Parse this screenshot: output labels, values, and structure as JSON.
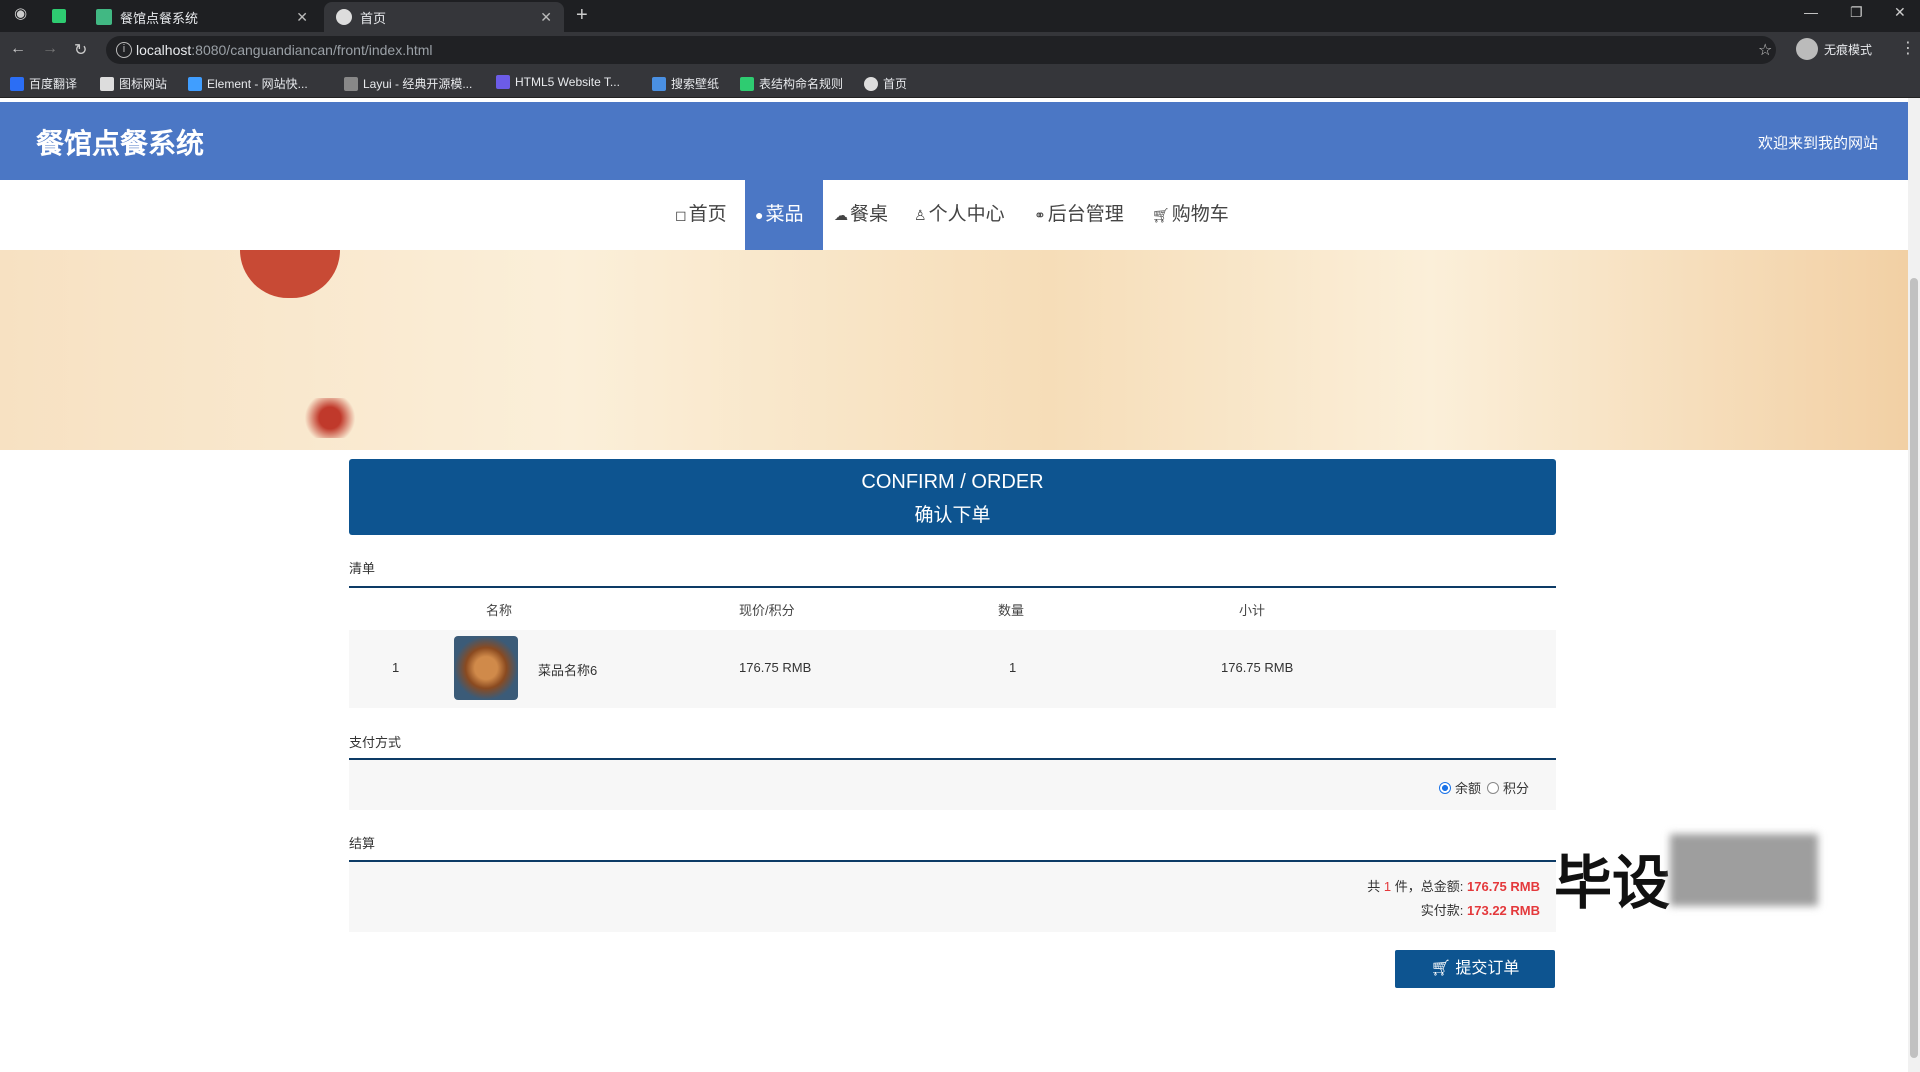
{
  "browser": {
    "tabs": [
      {
        "title": "餐馆点餐系统",
        "active": false
      },
      {
        "title": "首页",
        "active": true
      }
    ],
    "url_host": "localhost",
    "url_rest": ":8080/canguandiancan/front/index.html",
    "profile_label": "无痕模式",
    "bookmarks": [
      "百度翻译",
      "图标网站",
      "Element - 网站快...",
      "Layui - 经典开源模...",
      "HTML5 Website T...",
      "搜索壁纸",
      "表结构命名规则",
      "首页"
    ]
  },
  "site": {
    "title": "餐馆点餐系统",
    "welcome": "欢迎来到我的网站"
  },
  "nav": {
    "items": [
      "首页",
      "菜品",
      "餐桌",
      "个人中心",
      "后台管理",
      "购物车"
    ],
    "active": "菜品"
  },
  "confirm": {
    "title_en": "CONFIRM / ORDER",
    "title_zh": "确认下单"
  },
  "list": {
    "label": "清单",
    "headers": [
      "名称",
      "现价/积分",
      "数量",
      "小计"
    ],
    "rows": [
      {
        "index": "1",
        "name": "菜品名称6",
        "price": "176.75 RMB",
        "qty": "1",
        "subtotal": "176.75 RMB"
      }
    ]
  },
  "payment": {
    "label": "支付方式",
    "options": [
      "余额",
      "积分"
    ],
    "selected": "余额"
  },
  "settle": {
    "label": "结算",
    "count_prefix": "共",
    "count": "1",
    "count_suffix": "件，总金额:",
    "total": "176.75 RMB",
    "paid_label": "实付款:",
    "paid": "173.22 RMB"
  },
  "submit_label": "提交订单",
  "watermark": "毕设",
  "colors": {
    "header": "#4b77c5",
    "confirm": "#0d5490",
    "price_red": "#e4393c"
  }
}
